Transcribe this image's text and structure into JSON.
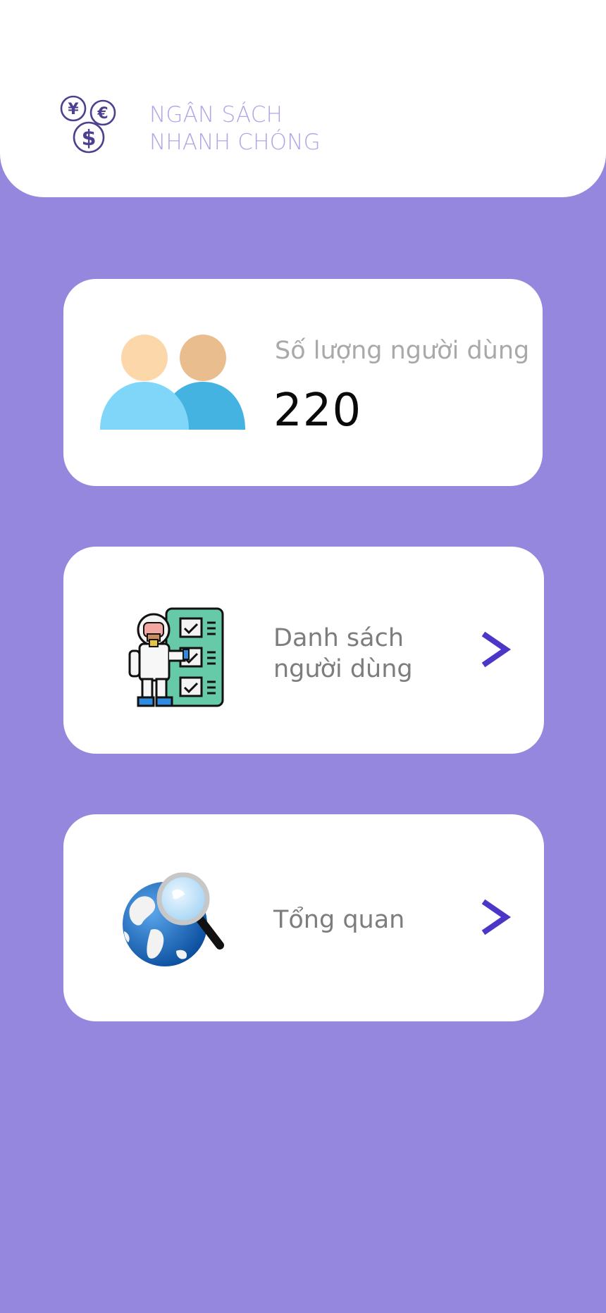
{
  "header": {
    "brand_line1": "NGÂN SÁCH",
    "brand_line2": "NHANH CHÓNG",
    "logo_icon": "currency-coins-icon"
  },
  "user_count_card": {
    "label": "Số lượng người dùng",
    "value": "220",
    "icon": "users-icon"
  },
  "menu": [
    {
      "label_line1": "Danh sách",
      "label_line2": "người dùng",
      "icon": "worker-checklist-icon"
    },
    {
      "label_line1": "Tổng quan",
      "label_line2": "",
      "icon": "globe-magnifier-icon"
    }
  ],
  "colors": {
    "background": "#9587dd",
    "brand_text": "#b1a5e8",
    "accent": "#4a37c7"
  }
}
